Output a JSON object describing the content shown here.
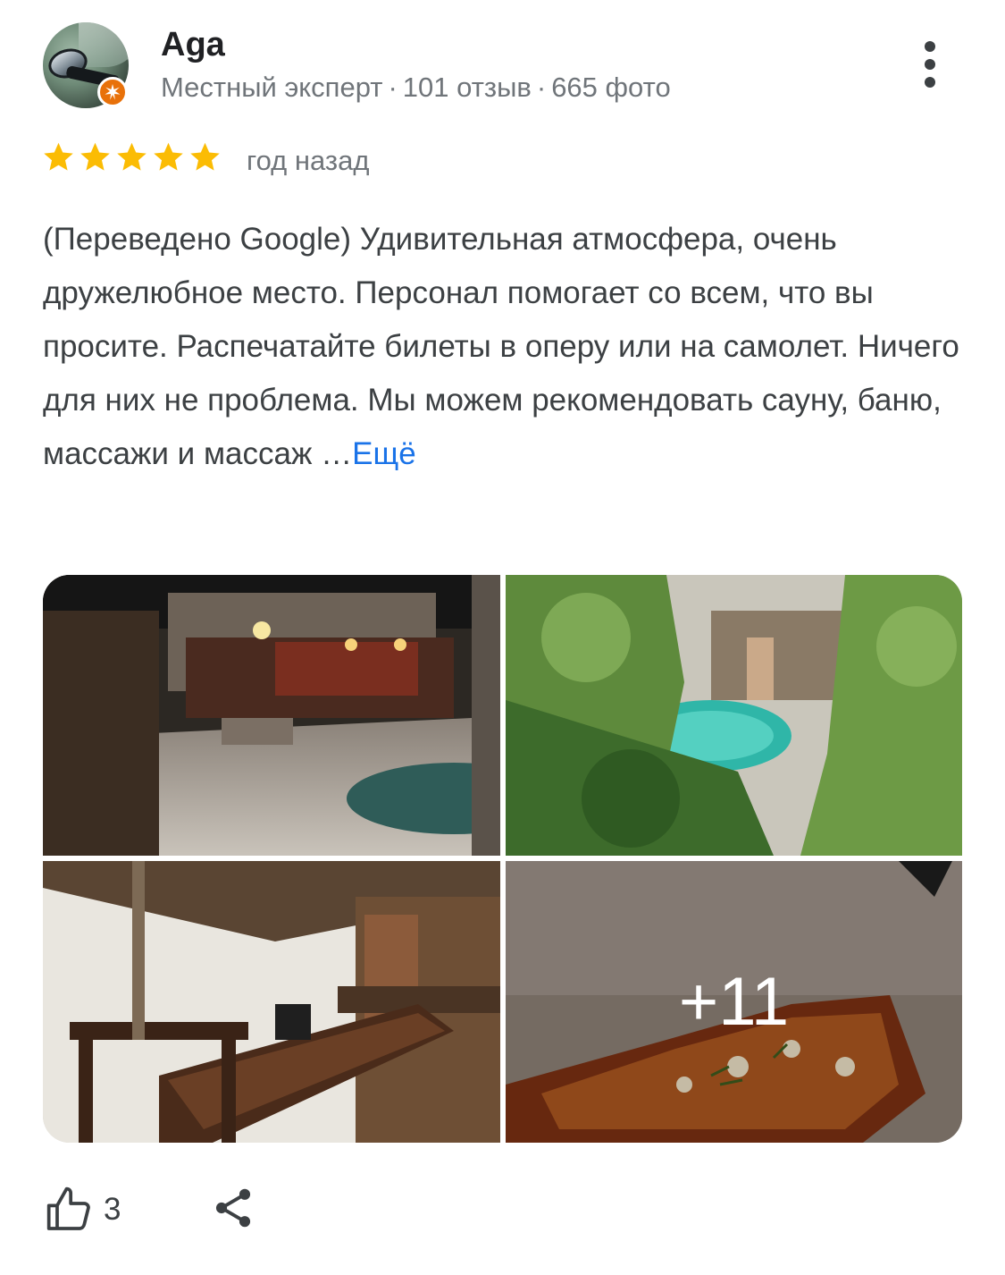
{
  "reviewer": {
    "name": "Aga",
    "level": "Местный эксперт",
    "reviews": "101 отзыв",
    "photos": "665 фото",
    "separator": "·"
  },
  "rating": {
    "stars": 5,
    "max": 5,
    "color": "#fbbc04"
  },
  "time_ago": "год назад",
  "review_text": "(Переведено Google) Удивительная атмосфера, очень дружелюбное место. Персонал помогает со всем, что вы просите. Распечатайте билеты в оперу или на самолет. Ничего для них не проблема. Мы можем рекомендовать сауну, баню, массажи и массаж …",
  "more_label": "Ещё",
  "photos_more_count": "+11",
  "likes": "3",
  "colors": {
    "accent": "#1a73e8",
    "badge": "#e8710a",
    "secondary_text": "#70757a"
  },
  "icons": {
    "menu": "more-vert-icon",
    "like": "thumb-up-icon",
    "share": "share-icon",
    "badge": "local-guide-badge-icon"
  }
}
